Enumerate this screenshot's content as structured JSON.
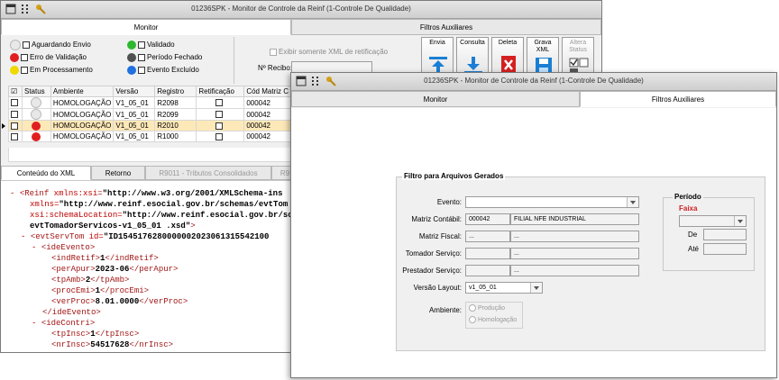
{
  "back_window": {
    "title": "01236SPK - Monitor de Controle da Reinf (1-Controle De Qualidade)",
    "tabs": [
      "Monitor",
      "Filtros Auxiliares"
    ],
    "legend": [
      {
        "label": "Aguardando Envio",
        "color": "#e8e8e8"
      },
      {
        "label": "Validado",
        "color": "#2eb82e"
      },
      {
        "label": "Erro de Validação",
        "color": "#e02020"
      },
      {
        "label": "Período Fechado",
        "color": "#505050"
      },
      {
        "label": "Em Processamento",
        "color": "#f0d800"
      },
      {
        "label": "Evento Excluído",
        "color": "#2070e0"
      }
    ],
    "retificacao_label": "Exibir somente XML de retificação",
    "recibo_label": "Nº Recibo:",
    "toolbar": {
      "envia": "Envia",
      "consulta": "Consulta",
      "deleta": "Deleta",
      "grava_xml": "Grava XML",
      "altera_status": "Altera Status"
    },
    "grid": {
      "headers": [
        "☑",
        "Status",
        "Ambiente",
        "Versão",
        "Registro",
        "Retificação",
        "Cód Matriz C"
      ],
      "rows": [
        {
          "status": "#e8e8e8",
          "ambiente": "HOMOLOGAÇÃO",
          "versao": "V1_05_01",
          "registro": "R2098",
          "cod": "000042"
        },
        {
          "status": "#e8e8e8",
          "ambiente": "HOMOLOGAÇÃO",
          "versao": "V1_05_01",
          "registro": "R2099",
          "cod": "000042"
        },
        {
          "status": "#e02020",
          "ambiente": "HOMOLOGAÇÃO",
          "versao": "V1_05_01",
          "registro": "R2010",
          "cod": "000042"
        },
        {
          "status": "#e02020",
          "ambiente": "HOMOLOGAÇÃO",
          "versao": "V1_05_01",
          "registro": "R1000",
          "cod": "000042"
        }
      ]
    },
    "bottom_tabs": [
      "Conteúdo do XML",
      "Retorno",
      "R9011 - Tributos Consolidados",
      "R9"
    ],
    "xml": {
      "l1_open": "<Reinf ",
      "l1_attr": "xmlns:xsi=",
      "l1_val": "\"http://www.w3.org/2001/XMLSchema-ins",
      "l2_attr": "xmlns=",
      "l2_val": "\"http://www.reinf.esocial.gov.br/schemas/evtTom",
      "l3_attr": "xsi:schemaLocation=",
      "l3_val": "\"http://www.reinf.esocial.gov.br/schem",
      "l4_val": "evtTomadorServicos-v1_05_01 .xsd\"",
      "l4_close": ">",
      "l5_open": "<evtServTom ",
      "l5_attr": "id=",
      "l5_val": "\"ID1545176280000002023061315542100",
      "l6": "<ideEvento>",
      "l7_open": "<indRetif>",
      "l7_val": "1",
      "l7_close": "</indRetif>",
      "l8_open": "<perApur>",
      "l8_val": "2023-06",
      "l8_close": "</perApur>",
      "l9_open": "<tpAmb>",
      "l9_val": "2",
      "l9_close": "</tpAmb>",
      "l10_open": "<procEmi>",
      "l10_val": "1",
      "l10_close": "</procEmi>",
      "l11_open": "<verProc>",
      "l11_val": "8.01.0000",
      "l11_close": "</verProc>",
      "l12": "</ideEvento>",
      "l13": "<ideContri>",
      "l14_open": "<tpInsc>",
      "l14_val": "1",
      "l14_close": "</tpInsc>",
      "l15_open": "<nrInsc>",
      "l15_val": "54517628",
      "l15_close": "</nrInsc>"
    }
  },
  "front_window": {
    "title": "01236SPK - Monitor de Controle da Reinf (1-Controle De Qualidade)",
    "tabs": [
      "Monitor",
      "Filtros Auxiliares"
    ],
    "group_title": "Filtro para Arquivos Gerados",
    "evento_label": "Evento:",
    "evento_value": "",
    "matriz_label": "Matriz Contábil:",
    "matriz_code": "000042",
    "matriz_name": "FILIAL NFE INDUSTRIAL",
    "fiscal_label": "Matriz Fiscal:",
    "fiscal_code": "...",
    "fiscal_name": "...",
    "tomador_label": "Tomador Serviço:",
    "tomador_code": "",
    "tomador_name": "...",
    "prestador_label": "Prestador Serviço:",
    "prestador_code": "",
    "prestador_name": "...",
    "versao_label": "Versão Layout:",
    "versao_value": "v1_05_01",
    "ambiente_label": "Ambiente:",
    "ambiente_options": [
      "Produção",
      "Homologação"
    ],
    "periodo_title": "Período",
    "faixa_label": "Faixa",
    "de_label": "De",
    "ate_label": "Até"
  }
}
